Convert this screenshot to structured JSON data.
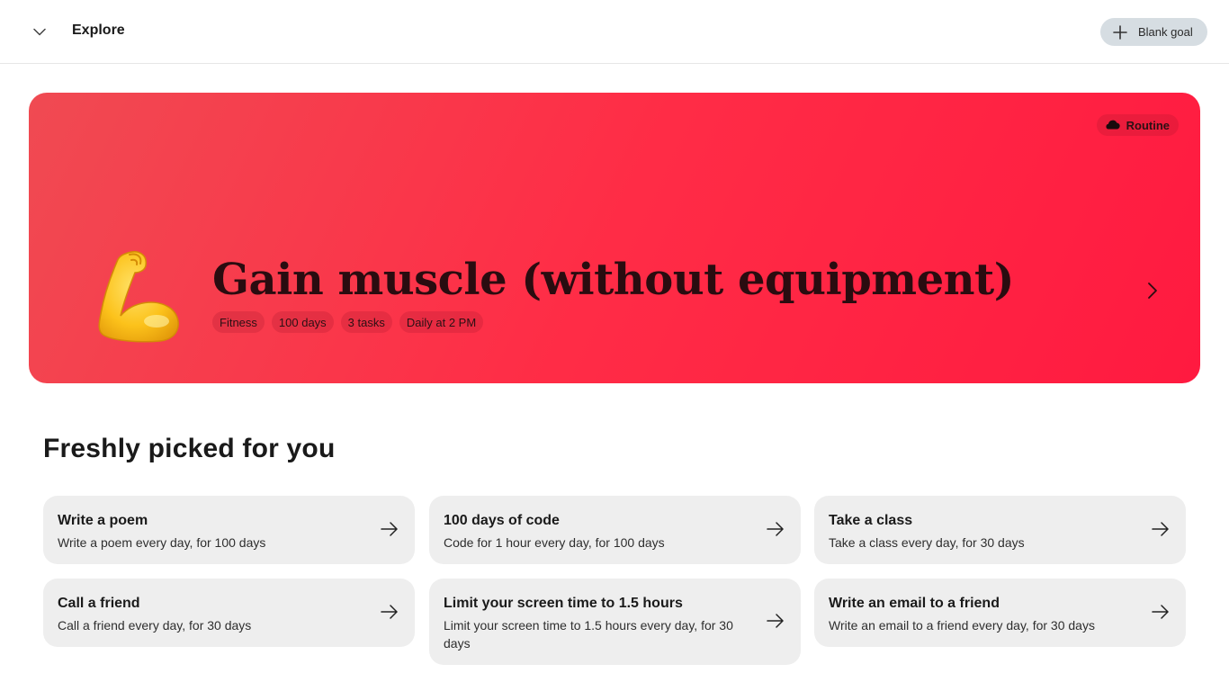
{
  "header": {
    "title": "Explore",
    "blank_goal_label": "Blank goal"
  },
  "hero": {
    "badge_label": "Routine",
    "title": "Gain muscle (without equipment)",
    "emoji": "flexed-biceps",
    "tags": [
      "Fitness",
      "100 days",
      "3 tasks",
      "Daily at 2 PM"
    ],
    "gradient_colors": [
      "#f04a52",
      "#ff2c46",
      "#ff1a40"
    ]
  },
  "section": {
    "title": "Freshly picked for you"
  },
  "cards": [
    {
      "title": "Write a poem",
      "subtitle": "Write a poem every day, for 100 days"
    },
    {
      "title": "100 days of code",
      "subtitle": "Code for 1 hour every day, for 100 days"
    },
    {
      "title": "Take a class",
      "subtitle": "Take a class every day, for 30 days"
    },
    {
      "title": "Call a friend",
      "subtitle": "Call a friend every day, for 30 days"
    },
    {
      "title": "Limit your screen time to 1.5 hours",
      "subtitle": "Limit your screen time to 1.5 hours every day, for 30 days"
    },
    {
      "title": "Write an email to a friend",
      "subtitle": "Write an email to a friend every day, for 30 days"
    }
  ],
  "colors": {
    "card_bg": "#eeeeee",
    "button_bg": "#d6dde2"
  }
}
